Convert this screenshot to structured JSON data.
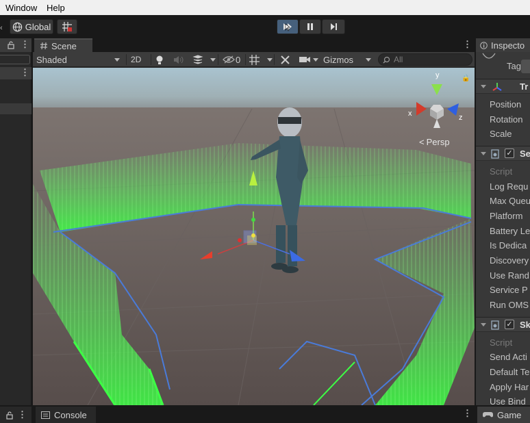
{
  "menu": {
    "window": "Window",
    "help": "Help"
  },
  "toolbar": {
    "global_label": "Global"
  },
  "scene": {
    "tab_label": "Scene",
    "shading_mode": "Shaded",
    "mode_2d": "2D",
    "hidden_count": "0",
    "gizmos_label": "Gizmos",
    "search_placeholder": "All",
    "projection_label": "Persp",
    "axis_x": "x",
    "axis_y": "y",
    "axis_z": "z"
  },
  "inspector": {
    "tab_label": "Inspecto",
    "tag_label": "Tag",
    "transform": {
      "header": "Tr",
      "position": "Position",
      "rotation": "Rotation",
      "scale": "Scale"
    },
    "component1": {
      "header": "Se",
      "enabled": true,
      "fields": [
        "Script",
        "Log Requ",
        "Max Queu",
        "Platform",
        "Battery Le",
        "Is Dedica",
        "Discovery",
        "Use Rand",
        "Service P",
        "Run OMS"
      ]
    },
    "component2": {
      "header": "Sk",
      "enabled": true,
      "fields": [
        "Script",
        "Send Acti",
        "Default Te",
        "Apply Har",
        "Use Bind"
      ]
    }
  },
  "bottom": {
    "console_label": "Console",
    "game_label": "Game"
  }
}
